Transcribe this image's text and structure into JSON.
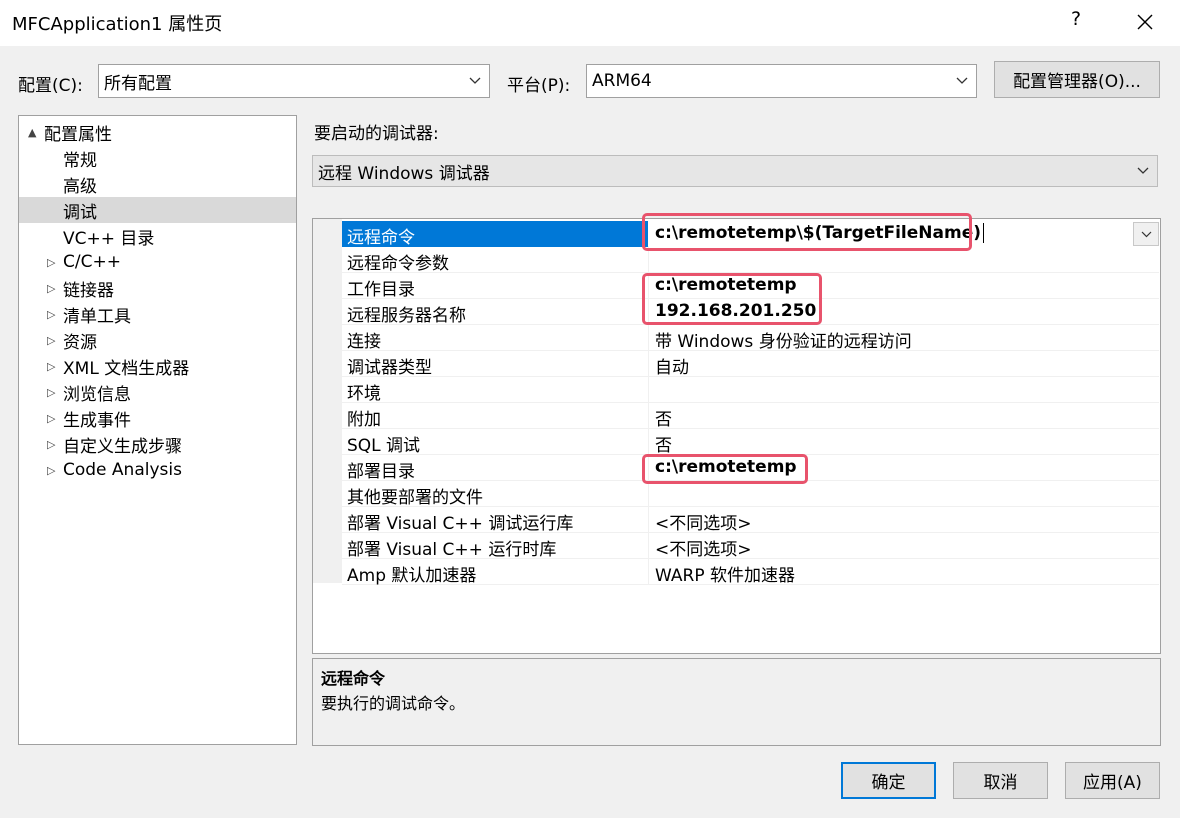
{
  "window": {
    "title": "MFCApplication1 属性页",
    "help_label": "?",
    "close_icon": "close-icon"
  },
  "toolbar": {
    "config_label": "配置(C):",
    "config_value": "所有配置",
    "platform_label": "平台(P):",
    "platform_value": "ARM64",
    "config_manager_label": "配置管理器(O)..."
  },
  "tree": {
    "items": [
      {
        "label": "配置属性",
        "expander": "▲",
        "level": 0
      },
      {
        "label": "常规",
        "expander": "",
        "level": 1
      },
      {
        "label": "高级",
        "expander": "",
        "level": 1
      },
      {
        "label": "调试",
        "expander": "",
        "level": 1,
        "selected": true
      },
      {
        "label": "VC++ 目录",
        "expander": "",
        "level": 1
      },
      {
        "label": "C/C++",
        "expander": "▷",
        "level": 1
      },
      {
        "label": "链接器",
        "expander": "▷",
        "level": 1
      },
      {
        "label": "清单工具",
        "expander": "▷",
        "level": 1
      },
      {
        "label": "资源",
        "expander": "▷",
        "level": 1
      },
      {
        "label": "XML 文档生成器",
        "expander": "▷",
        "level": 1
      },
      {
        "label": "浏览信息",
        "expander": "▷",
        "level": 1
      },
      {
        "label": "生成事件",
        "expander": "▷",
        "level": 1
      },
      {
        "label": "自定义生成步骤",
        "expander": "▷",
        "level": 1
      },
      {
        "label": "Code Analysis",
        "expander": "▷",
        "level": 1
      }
    ]
  },
  "debugger": {
    "label": "要启动的调试器:",
    "value": "远程 Windows 调试器"
  },
  "properties": {
    "rows": [
      {
        "name": "远程命令",
        "value": "c:\\remotetemp\\$(TargetFileName)",
        "bold": true,
        "selected": true
      },
      {
        "name": "远程命令参数",
        "value": "",
        "bold": false
      },
      {
        "name": "工作目录",
        "value": "c:\\remotetemp",
        "bold": true
      },
      {
        "name": "远程服务器名称",
        "value": "192.168.201.250",
        "bold": true
      },
      {
        "name": "连接",
        "value": "带 Windows 身份验证的远程访问",
        "bold": false
      },
      {
        "name": "调试器类型",
        "value": "自动",
        "bold": false
      },
      {
        "name": "环境",
        "value": "",
        "bold": false
      },
      {
        "name": "附加",
        "value": "否",
        "bold": false
      },
      {
        "name": "SQL 调试",
        "value": "否",
        "bold": false
      },
      {
        "name": "部署目录",
        "value": "c:\\remotetemp",
        "bold": true
      },
      {
        "name": "其他要部署的文件",
        "value": "",
        "bold": false
      },
      {
        "name": "部署 Visual C++ 调试运行库",
        "value": "<不同选项>",
        "bold": false
      },
      {
        "name": "部署 Visual C++ 运行时库",
        "value": "<不同选项>",
        "bold": false
      },
      {
        "name": "Amp 默认加速器",
        "value": "WARP 软件加速器",
        "bold": false
      }
    ]
  },
  "description": {
    "title": "远程命令",
    "text": "要执行的调试命令。"
  },
  "buttons": {
    "ok": "确定",
    "cancel": "取消",
    "apply": "应用(A)"
  },
  "colors": {
    "selection": "#0078d7",
    "highlight": "#e8536c",
    "tree_selected": "#d9d9d9"
  }
}
